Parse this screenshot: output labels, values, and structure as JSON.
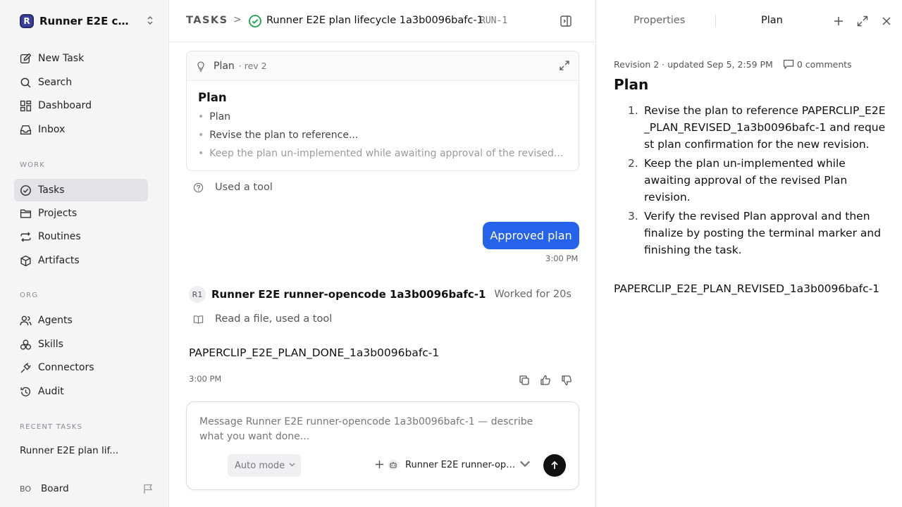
{
  "workspace": {
    "logo": "R",
    "name": "Runner E2E co..."
  },
  "nav_primary": [
    {
      "label": "New Task",
      "icon": "edit-icon"
    },
    {
      "label": "Search",
      "icon": "search-icon"
    },
    {
      "label": "Dashboard",
      "icon": "dashboard-icon"
    },
    {
      "label": "Inbox",
      "icon": "inbox-icon"
    }
  ],
  "sections": {
    "work": "WORK",
    "org": "ORG",
    "recent": "RECENT TASKS"
  },
  "nav_work": [
    {
      "label": "Tasks",
      "active": true
    },
    {
      "label": "Projects"
    },
    {
      "label": "Routines"
    },
    {
      "label": "Artifacts"
    }
  ],
  "nav_org": [
    {
      "label": "Agents"
    },
    {
      "label": "Skills"
    },
    {
      "label": "Connectors"
    },
    {
      "label": "Audit"
    }
  ],
  "recent_task": "Runner E2E plan lif...",
  "board": {
    "avatar": "BO",
    "label": "Board"
  },
  "header": {
    "root": "TASKS",
    "separator": ">",
    "title": "Runner E2E plan lifecycle 1a3b0096bafc-1",
    "id": "RUN-1"
  },
  "plan_card": {
    "label": "Plan",
    "rev": "· rev 2",
    "heading": "Plan",
    "items": [
      "Plan",
      "Revise the plan to reference...",
      "Keep the plan un-implemented while awaiting approval of the revised..."
    ]
  },
  "messages": {
    "tool1": "Used a tool",
    "user_message": "Approved plan",
    "user_time": "3:00 PM",
    "agent_avatar": "R1",
    "agent_name": "Runner E2E runner-opencode 1a3b0096bafc-1",
    "agent_worked": "Worked for 20s",
    "tool2": "Read a file, used a tool",
    "agent_output": "PAPERCLIP_E2E_PLAN_DONE_1a3b0096bafc-1",
    "agent_time": "3:00 PM"
  },
  "composer": {
    "placeholder": "Message Runner E2E runner-opencode 1a3b0096bafc-1 — describe what you want done...",
    "mode": "Auto mode",
    "agent": "Runner E2E runner-open..."
  },
  "right_panel": {
    "tabs": [
      "Properties",
      "Plan"
    ],
    "meta": "Revision 2 · updated Sep 5, 2:59 PM",
    "comments": "0 comments",
    "title": "Plan",
    "items": [
      {
        "num": "1.",
        "text": "Revise the plan to reference PAPERCLIP_E2E_PLAN_REVISED_1a3b0096bafc-1 and request plan confirmation for the new revision."
      },
      {
        "num": "2.",
        "text": "Keep the plan un-implemented while awaiting approval of the revised Plan revision."
      },
      {
        "num": "3.",
        "text": "Verify the revised Plan approval and then finalize by posting the terminal marker and finishing the task."
      }
    ],
    "footer": "PAPERCLIP_E2E_PLAN_REVISED_1a3b0096bafc-1"
  },
  "colors": {
    "accent": "#2563eb",
    "success": "#16a34a",
    "sidebar_bg": "#f5f5f6"
  }
}
